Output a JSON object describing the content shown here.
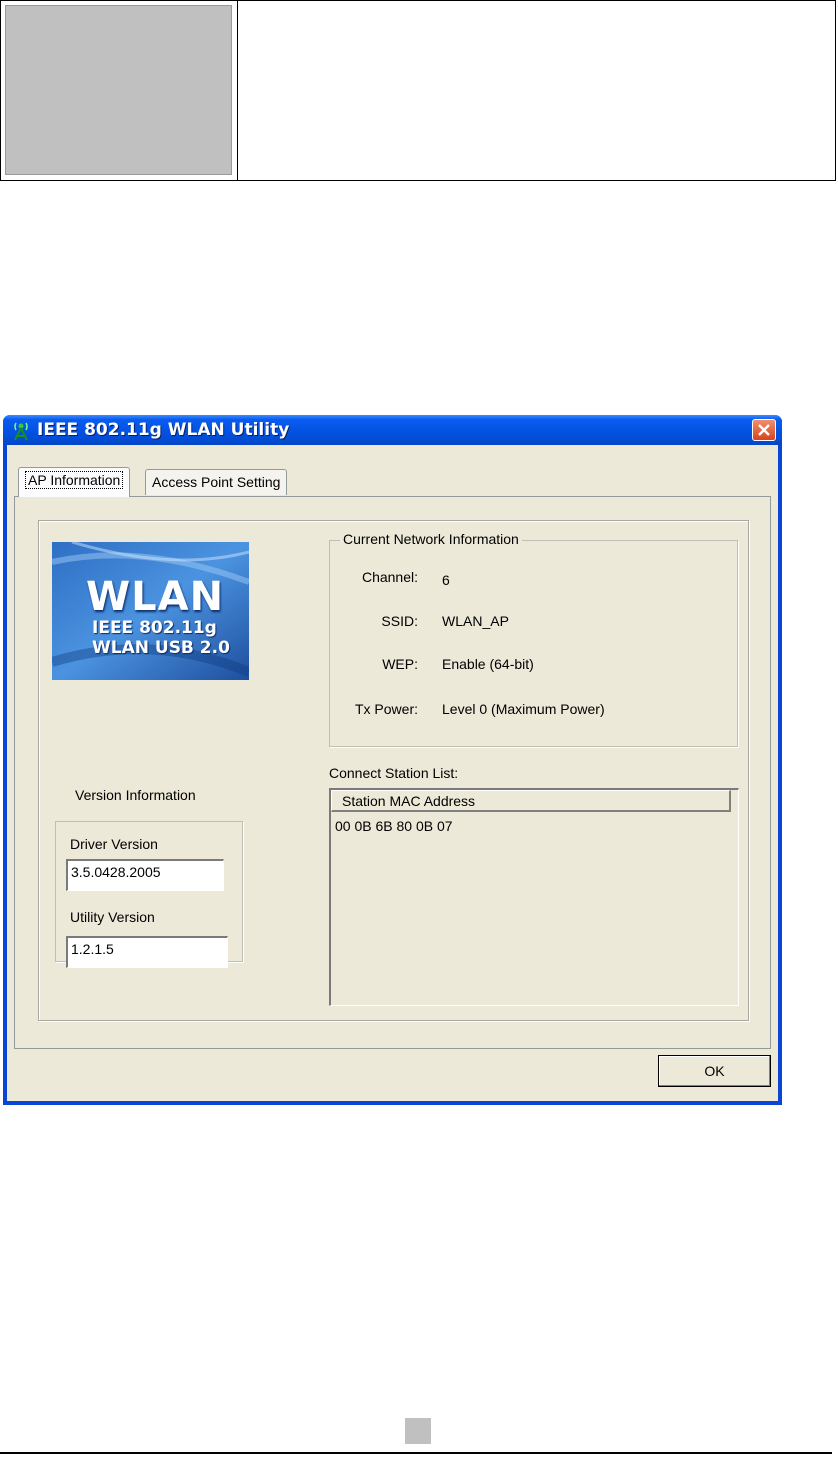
{
  "window": {
    "title": "IEEE 802.11g WLAN Utility",
    "close_label": "×"
  },
  "tabs": [
    {
      "label": "AP Information",
      "active": true
    },
    {
      "label": "Access Point Setting",
      "active": false
    }
  ],
  "logo": {
    "line1": "WLAN",
    "line2": "IEEE 802.11g",
    "line3": "WLAN USB 2.0"
  },
  "network": {
    "group_title": "Current Network Information",
    "fields": [
      {
        "label": "Channel:",
        "value": "6"
      },
      {
        "label": "SSID:",
        "value": "WLAN_AP"
      },
      {
        "label": "WEP:",
        "value": "Enable (64-bit)"
      },
      {
        "label": "Tx Power:",
        "value": "Level 0 (Maximum Power)"
      }
    ]
  },
  "version": {
    "heading": "Version Information",
    "driver_label": "Driver Version",
    "driver_value": "3.5.0428.2005",
    "utility_label": "Utility Version",
    "utility_value": "1.2.1.5"
  },
  "stations": {
    "label": "Connect Station List:",
    "column_header": "Station MAC Address",
    "rows": [
      "00 0B 6B 80 0B 07"
    ]
  },
  "buttons": {
    "ok_label": "OK"
  },
  "colors": {
    "titlebar": "#0251e0",
    "dialog_face": "#ece9d8",
    "close_button": "#d8431c"
  }
}
